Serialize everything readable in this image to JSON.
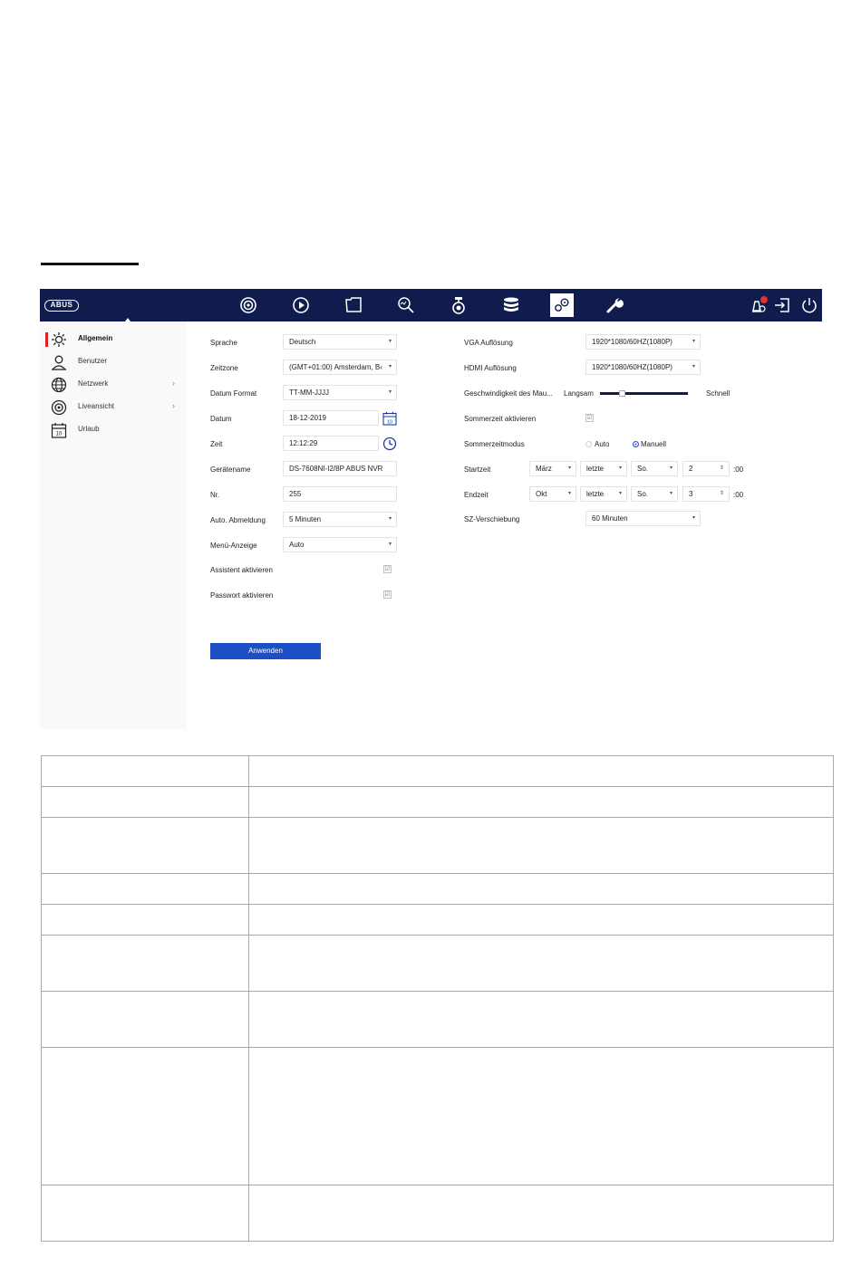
{
  "app": {
    "logo_text": "ABUS",
    "nav_icons": [
      "live-view-icon",
      "playback-icon",
      "file-icon",
      "search-icon",
      "camera-icon",
      "storage-icon",
      "settings-icon",
      "wrench-icon"
    ],
    "right_icons": [
      "alarm-icon",
      "logout-icon",
      "power-icon"
    ],
    "accent_color": "#0f1c4d",
    "button_color": "#1c4fc4",
    "active_marker_color": "#e02020"
  },
  "sidebar": {
    "items": [
      {
        "label": "Allgemein",
        "icon": "gear-icon"
      },
      {
        "label": "Benutzer",
        "icon": "user-icon"
      },
      {
        "label": "Netzwerk",
        "icon": "globe-icon",
        "chevron": "›"
      },
      {
        "label": "Liveansicht",
        "icon": "camera-lens-icon",
        "chevron": "›"
      },
      {
        "label": "Urlaub",
        "icon": "calendar-icon"
      }
    ]
  },
  "form_left": {
    "sprache": {
      "label": "Sprache",
      "value": "Deutsch"
    },
    "zeitzone": {
      "label": "Zeitzone",
      "value": "(GMT+01:00) Amsterdam, B‹"
    },
    "datum_format": {
      "label": "Datum Format",
      "value": "TT-MM-JJJJ"
    },
    "datum": {
      "label": "Datum",
      "value": "18-12-2019",
      "icon_text": "10"
    },
    "zeit": {
      "label": "Zeit",
      "value": "12:12:29"
    },
    "geraetename": {
      "label": "Gerätename",
      "value": "DS-7608NI-I2/8P ABUS NVR"
    },
    "nr": {
      "label": "Nr.",
      "value": "255"
    },
    "auto_abmeldung": {
      "label": "Auto. Abmeldung",
      "value": "5 Minuten"
    },
    "menue_anzeige": {
      "label": "Menü-Anzeige",
      "value": "Auto"
    },
    "assistent": {
      "label": "Assistent aktivieren",
      "check": "☑"
    },
    "passwort": {
      "label": "Passwort aktivieren",
      "check": "☑"
    },
    "apply_label": "Anwenden"
  },
  "form_right": {
    "vga": {
      "label": "VGA Auflösung",
      "value": "1920*1080/60HZ(1080P)"
    },
    "hdmi": {
      "label": "HDMI Auflösung",
      "value": "1920*1080/60HZ(1080P)"
    },
    "maus": {
      "label": "Geschwindigkeit des Mau...",
      "min_label": "Langsam",
      "max_label": "Schnell",
      "level": 0.25
    },
    "sommerzeit": {
      "label": "Sommerzeit aktivieren",
      "check": "☑"
    },
    "sommerzeitmodus": {
      "label": "Sommerzeitmodus",
      "option_auto": "Auto",
      "option_manual": "Manuell",
      "selected": "Manuell"
    },
    "startzeit": {
      "label": "Startzeit",
      "month": "März",
      "week": "letzte",
      "day": "So.",
      "hour": "2",
      "minutes": ":00"
    },
    "endzeit": {
      "label": "Endzeit",
      "month": "Okt",
      "week": "letzte",
      "day": "So.",
      "hour": "3",
      "minutes": ":00"
    },
    "sz_verschiebung": {
      "label": "SZ-Verschiebung",
      "value": "60 Minuten"
    }
  }
}
